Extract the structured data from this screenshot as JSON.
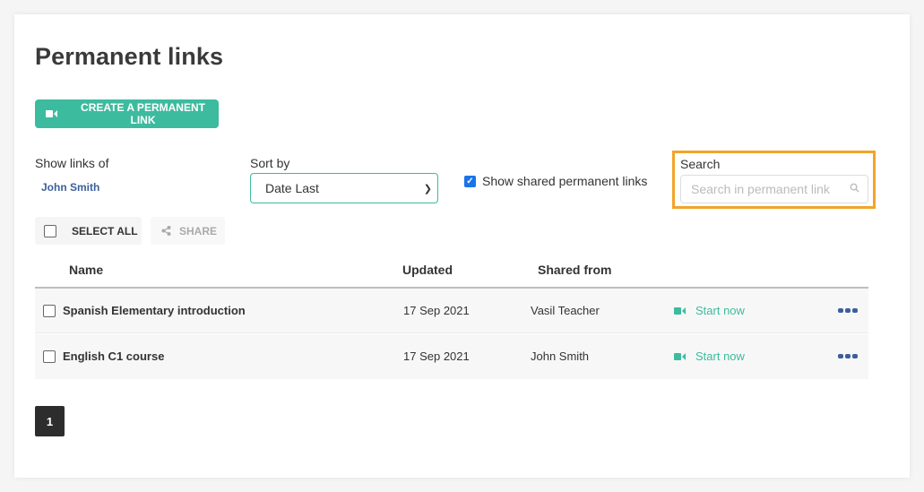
{
  "page": {
    "title": "Permanent links",
    "create_button_label": "CREATE A PERMANENT LINK"
  },
  "filters": {
    "show_links_label": "Show links of",
    "owner": "John Smith",
    "sort_label": "Sort by",
    "sort_value": "Date Last",
    "show_shared_label": "Show shared permanent links",
    "show_shared_checked": true,
    "search_label": "Search",
    "search_placeholder": "Search in permanent link",
    "search_value": ""
  },
  "toolbar": {
    "select_all_label": "SELECT ALL",
    "share_label": "SHARE"
  },
  "table": {
    "columns": [
      "Name",
      "Updated",
      "Shared from"
    ],
    "rows": [
      {
        "name": "Spanish Elementary introduction",
        "updated": "17 Sep 2021",
        "shared_from": "Vasil Teacher",
        "action": "Start now"
      },
      {
        "name": "English C1 course",
        "updated": "17 Sep 2021",
        "shared_from": "John Smith",
        "action": "Start now"
      }
    ]
  },
  "pagination": {
    "current_page": "1"
  },
  "colors": {
    "accent": "#3dbb9e",
    "link": "#3c5f9c",
    "highlight": "#f1a42a",
    "pagination_bg": "#2d2d2d"
  }
}
